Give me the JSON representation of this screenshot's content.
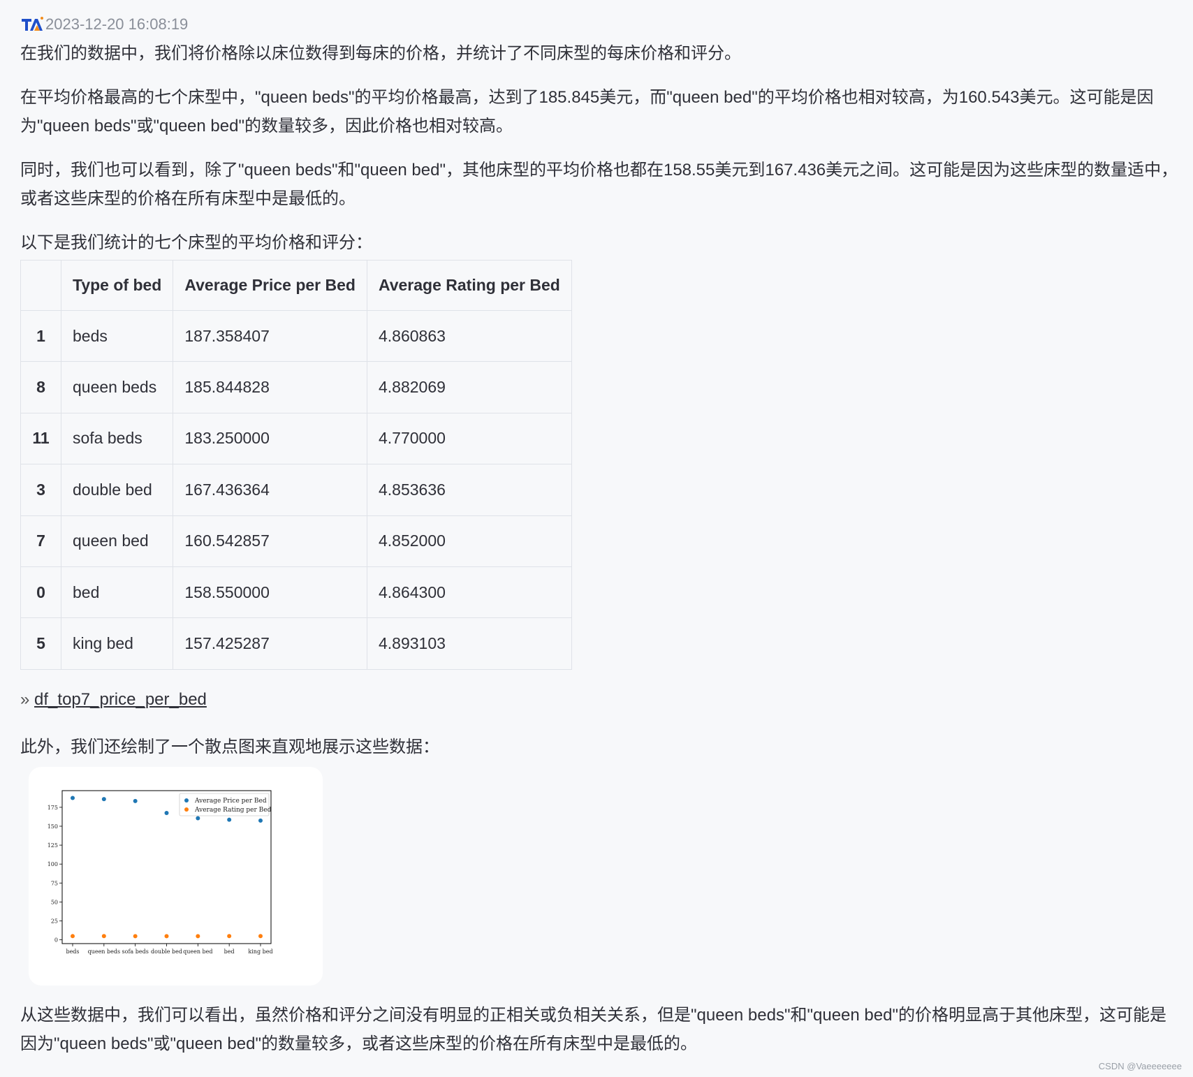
{
  "header": {
    "logo": "TA-logo-icon",
    "timestamp": "2023-12-20 16:08:19"
  },
  "paragraphs": {
    "p1": "在我们的数据中，我们将价格除以床位数得到每床的价格，并统计了不同床型的每床价格和评分。",
    "p2": "在平均价格最高的七个床型中，\"queen beds\"的平均价格最高，达到了185.845美元，而\"queen bed\"的平均价格也相对较高，为160.543美元。这可能是因为\"queen beds\"或\"queen bed\"的数量较多，因此价格也相对较高。",
    "p3": "同时，我们也可以看到，除了\"queen beds\"和\"queen bed\"，其他床型的平均价格也都在158.55美元到167.436美元之间。这可能是因为这些床型的数量适中，或者这些床型的价格在所有床型中是最低的。",
    "p4": "以下是我们统计的七个床型的平均价格和评分：",
    "p5": "此外，我们还绘制了一个散点图来直观地展示这些数据：",
    "p6": "从这些数据中，我们可以看出，虽然价格和评分之间没有明显的正相关或负相关关系，但是\"queen beds\"和\"queen bed\"的价格明显高于其他床型，这可能是因为\"queen beds\"或\"queen bed\"的数量较多，或者这些床型的价格在所有床型中是最低的。"
  },
  "table": {
    "headers": [
      "",
      "Type of bed",
      "Average Price per Bed",
      "Average Rating per Bed"
    ],
    "rows": [
      [
        "1",
        "beds",
        "187.358407",
        "4.860863"
      ],
      [
        "8",
        "queen beds",
        "185.844828",
        "4.882069"
      ],
      [
        "11",
        "sofa beds",
        "183.250000",
        "4.770000"
      ],
      [
        "3",
        "double bed",
        "167.436364",
        "4.853636"
      ],
      [
        "7",
        "queen bed",
        "160.542857",
        "4.852000"
      ],
      [
        "0",
        "bed",
        "158.550000",
        "4.864300"
      ],
      [
        "5",
        "king bed",
        "157.425287",
        "4.893103"
      ]
    ]
  },
  "reference": {
    "arrow": "»",
    "link": "df_top7_price_per_bed"
  },
  "chart_data": {
    "type": "scatter",
    "categories": [
      "beds",
      "queen beds",
      "sofa beds",
      "double bed",
      "queen bed",
      "bed",
      "king bed"
    ],
    "series": [
      {
        "name": "Average Price per Bed",
        "color": "#1f77b4",
        "values": [
          187.358407,
          185.844828,
          183.25,
          167.436364,
          160.542857,
          158.55,
          157.425287
        ]
      },
      {
        "name": "Average Rating per Bed",
        "color": "#ff7f0e",
        "values": [
          4.860863,
          4.882069,
          4.77,
          4.853636,
          4.852,
          4.8643,
          4.893103
        ]
      }
    ],
    "yticks": [
      0,
      25,
      50,
      75,
      100,
      125,
      150,
      175
    ],
    "ylim": [
      -5,
      197
    ],
    "legend": "top-right",
    "grid": false,
    "title": "",
    "xlabel": "",
    "ylabel": ""
  },
  "watermark": "CSDN @Vaeeeeeee"
}
